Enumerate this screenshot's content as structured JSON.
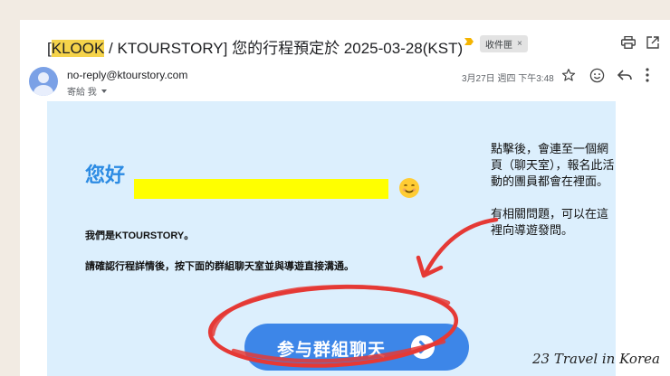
{
  "email": {
    "subject_prefix": "[",
    "subject_highlight": "KLOOK",
    "subject_rest": " / KTOURSTORY] 您的行程預定於 2025-03-28(KST)",
    "label": "收件匣",
    "label_close": "×",
    "sender": "no-reply@ktourstory.com",
    "recipient": "寄給 我",
    "date": "3月27日 週四 下午3:48"
  },
  "body": {
    "greeting": "您好",
    "intro": "我們是KTOURSTORY。",
    "instruction": "請確認行程詳情後，按下面的群組聊天室並與導遊直接溝通。",
    "cta_label": "参与群組聊天"
  },
  "annotation": {
    "note1": "點擊後，會連至一個網頁（聊天室），報名此活動的團員都會在裡面。",
    "note2": "有相關問題，可以在這裡向導遊發問。"
  },
  "watermark": "23 Travel in Korea",
  "colors": {
    "page_bg": "#f2ebe3",
    "card_bg": "#dceffd",
    "accent": "#3d86e8",
    "greeting": "#2c8be3",
    "redaction": "#ffff00",
    "marker": "#e53935"
  }
}
